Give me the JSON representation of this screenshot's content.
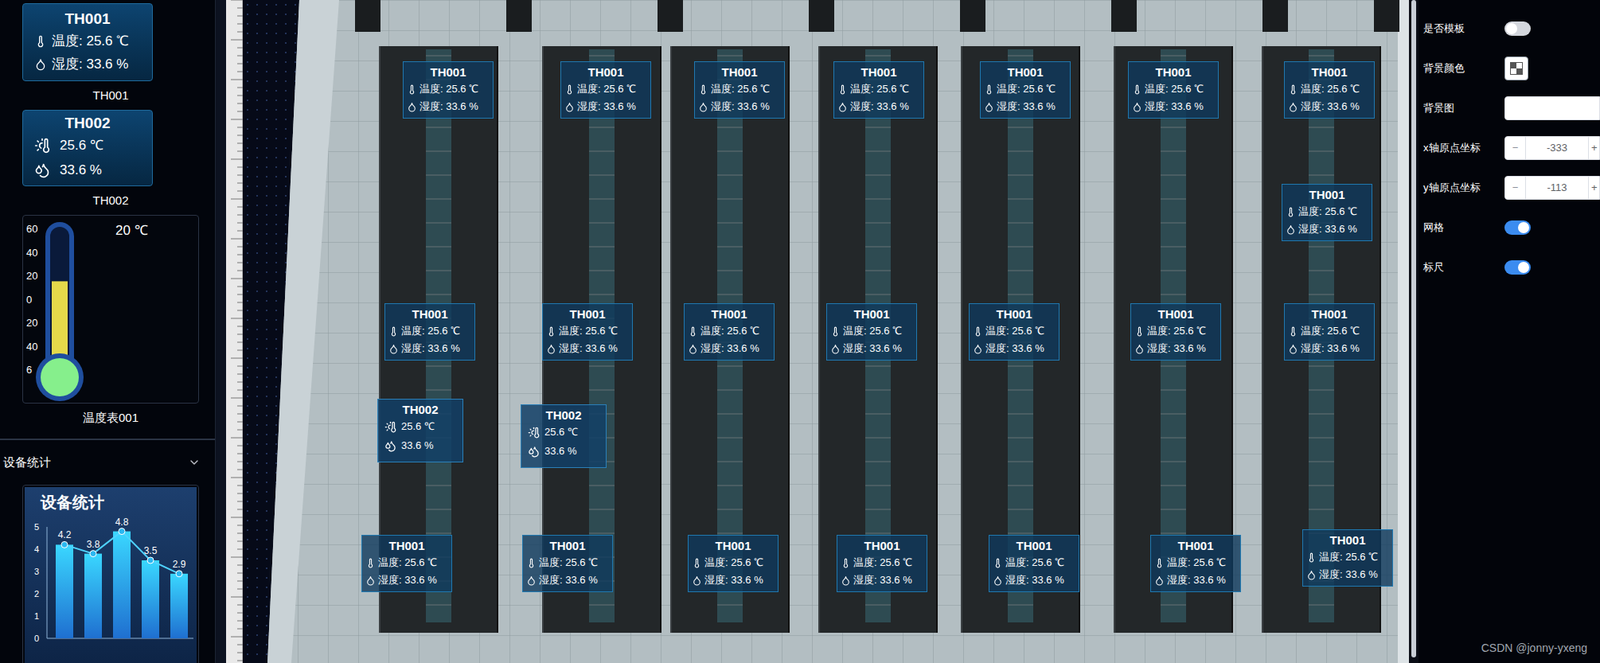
{
  "sidebar": {
    "components": [
      {
        "kind": "th001",
        "title": "TH001",
        "temperature": "温度: 25.6 ℃",
        "humidity": "湿度: 33.6 %",
        "caption": "TH001"
      },
      {
        "kind": "th002",
        "title": "TH002",
        "temperature": "25.6 ℃",
        "humidity": "33.6 %",
        "caption": "TH002"
      },
      {
        "kind": "thermometer",
        "reading": "20 ℃",
        "ticks": [
          "60",
          "40",
          "20",
          "0",
          "20",
          "40",
          "6"
        ],
        "level": 0.6,
        "caption": "温度表001"
      }
    ],
    "section": {
      "title": "设备统计",
      "expanded": true
    },
    "chart": {
      "title": "设备统计",
      "y_ticks": [
        "5",
        "4",
        "3",
        "2",
        "1",
        "0"
      ],
      "values": [
        4.2,
        3.8,
        4.8,
        3.5,
        2.9
      ],
      "value_labels": [
        "4.2",
        "3.8",
        "4.8",
        "3.5",
        "2.9"
      ]
    }
  },
  "canvas": {
    "widgets": [
      {
        "kind": "th001",
        "title": "TH001",
        "temperature": "温度: 25.6 ℃",
        "humidity": "湿度: 33.6 %"
      },
      {
        "kind": "th001",
        "title": "TH001",
        "temperature": "温度: 25.6 ℃",
        "humidity": "湿度: 33.6 %"
      },
      {
        "kind": "th001",
        "title": "TH001",
        "temperature": "温度: 25.6 ℃",
        "humidity": "湿度: 33.6 %"
      },
      {
        "kind": "th001",
        "title": "TH001",
        "temperature": "温度: 25.6 ℃",
        "humidity": "湿度: 33.6 %"
      },
      {
        "kind": "th001",
        "title": "TH001",
        "temperature": "温度: 25.6 ℃",
        "humidity": "湿度: 33.6 %"
      },
      {
        "kind": "th001",
        "title": "TH001",
        "temperature": "温度: 25.6 ℃",
        "humidity": "湿度: 33.6 %"
      },
      {
        "kind": "th001",
        "title": "TH001",
        "temperature": "温度: 25.6 ℃",
        "humidity": "湿度: 33.6 %"
      },
      {
        "kind": "th001",
        "title": "TH001",
        "temperature": "温度: 25.6 ℃",
        "humidity": "湿度: 33.6 %"
      },
      {
        "kind": "th001",
        "title": "TH001",
        "temperature": "温度: 25.6 ℃",
        "humidity": "湿度: 33.6 %"
      },
      {
        "kind": "th001",
        "title": "TH001",
        "temperature": "温度: 25.6 ℃",
        "humidity": "湿度: 33.6 %"
      },
      {
        "kind": "th001",
        "title": "TH001",
        "temperature": "温度: 25.6 ℃",
        "humidity": "湿度: 33.6 %"
      },
      {
        "kind": "th001",
        "title": "TH001",
        "temperature": "温度: 25.6 ℃",
        "humidity": "湿度: 33.6 %"
      },
      {
        "kind": "th001",
        "title": "TH001",
        "temperature": "温度: 25.6 ℃",
        "humidity": "湿度: 33.6 %"
      },
      {
        "kind": "th001",
        "title": "TH001",
        "temperature": "温度: 25.6 ℃",
        "humidity": "湿度: 33.6 %"
      },
      {
        "kind": "th001",
        "title": "TH001",
        "temperature": "温度: 25.6 ℃",
        "humidity": "湿度: 33.6 %"
      },
      {
        "kind": "th002",
        "title": "TH002",
        "temperature": "25.6 ℃",
        "humidity": "33.6 %"
      },
      {
        "kind": "th002",
        "title": "TH002",
        "temperature": "25.6 ℃",
        "humidity": "33.6 %"
      },
      {
        "kind": "th001",
        "title": "TH001",
        "temperature": "温度: 25.6 ℃",
        "humidity": "湿度: 33.6 %"
      },
      {
        "kind": "th001",
        "title": "TH001",
        "temperature": "温度: 25.6 ℃",
        "humidity": "湿度: 33.6 %"
      },
      {
        "kind": "th001",
        "title": "TH001",
        "temperature": "温度: 25.6 ℃",
        "humidity": "湿度: 33.6 %"
      },
      {
        "kind": "th001",
        "title": "TH001",
        "temperature": "温度: 25.6 ℃",
        "humidity": "湿度: 33.6 %"
      },
      {
        "kind": "th001",
        "title": "TH001",
        "temperature": "温度: 25.6 ℃",
        "humidity": "湿度: 33.6 %"
      },
      {
        "kind": "th001",
        "title": "TH001",
        "temperature": "温度: 25.6 ℃",
        "humidity": "湿度: 33.6 %"
      },
      {
        "kind": "th001",
        "title": "TH001",
        "temperature": "温度: 25.6 ℃",
        "humidity": "湿度: 33.6 %"
      }
    ]
  },
  "properties": [
    {
      "kind": "toggle",
      "label": "是否模板",
      "on": false
    },
    {
      "kind": "color",
      "label": "背景颜色"
    },
    {
      "kind": "input",
      "label": "背景图",
      "value": ""
    },
    {
      "kind": "stepper",
      "label": "x轴原点坐标",
      "value": "-333",
      "decrement": "−",
      "increment": "+"
    },
    {
      "kind": "stepper",
      "label": "y轴原点坐标",
      "value": "-113",
      "decrement": "−",
      "increment": "+"
    },
    {
      "kind": "toggle",
      "label": "网格",
      "on": true
    },
    {
      "kind": "toggle",
      "label": "标尺",
      "on": true
    }
  ],
  "watermark": "CSDN @jonny-yxeng"
}
